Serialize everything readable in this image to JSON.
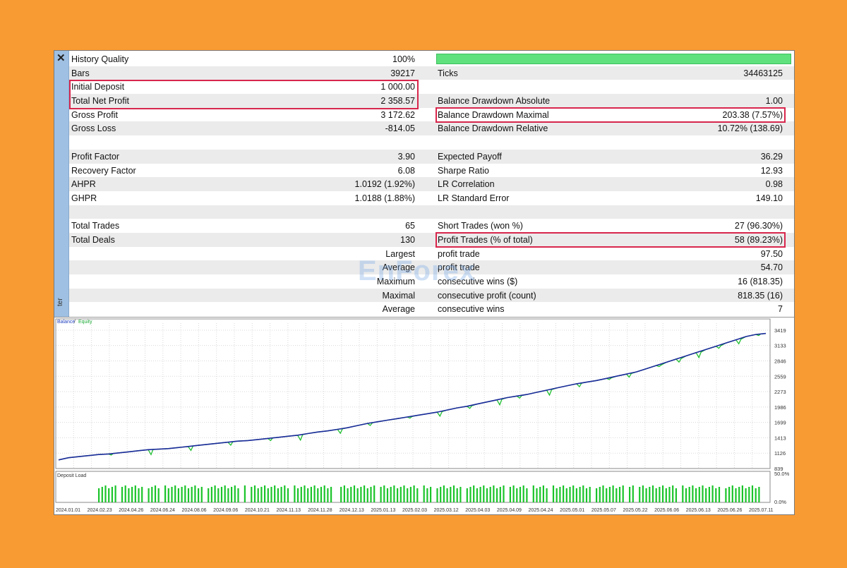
{
  "window": {
    "close_glyph": "✕",
    "vertical_label": "ter"
  },
  "rows": [
    {
      "l1": "History Quality",
      "v1": "100%",
      "l2": "",
      "v2": "",
      "bar": true
    },
    {
      "l1": "Bars",
      "v1": "39217",
      "l2": "Ticks",
      "v2": "34463125"
    },
    {
      "l1": "Initial Deposit",
      "v1": "1 000.00",
      "l2": "",
      "v2": ""
    },
    {
      "l1": "Total Net Profit",
      "v1": "2 358.57",
      "l2": "Balance Drawdown Absolute",
      "v2": "1.00"
    },
    {
      "l1": "Gross Profit",
      "v1": "3 172.62",
      "l2": "Balance Drawdown Maximal",
      "v2": "203.38 (7.57%)"
    },
    {
      "l1": "Gross Loss",
      "v1": "-814.05",
      "l2": "Balance Drawdown Relative",
      "v2": "10.72% (138.69)"
    },
    {
      "l1": "",
      "v1": "",
      "l2": "",
      "v2": ""
    },
    {
      "l1": "Profit Factor",
      "v1": "3.90",
      "l2": "Expected Payoff",
      "v2": "36.29"
    },
    {
      "l1": "Recovery Factor",
      "v1": "6.08",
      "l2": "Sharpe Ratio",
      "v2": "12.93"
    },
    {
      "l1": "AHPR",
      "v1": "1.0192 (1.92%)",
      "l2": "LR Correlation",
      "v2": "0.98"
    },
    {
      "l1": "GHPR",
      "v1": "1.0188 (1.88%)",
      "l2": "LR Standard Error",
      "v2": "149.10"
    },
    {
      "l1": "",
      "v1": "",
      "l2": "",
      "v2": ""
    },
    {
      "l1": "Total Trades",
      "v1": "65",
      "l2": "Short Trades (won %)",
      "v2": "27 (96.30%)"
    },
    {
      "l1": "Total Deals",
      "v1": "130",
      "l2": "Profit Trades (% of total)",
      "v2": "58 (89.23%)"
    },
    {
      "l1": "",
      "v1": "Largest",
      "l2": "profit trade",
      "v2": "97.50"
    },
    {
      "l1": "",
      "v1": "Average",
      "l2": "profit trade",
      "v2": "54.70"
    },
    {
      "l1": "",
      "v1": "Maximum",
      "l2": "consecutive wins ($)",
      "v2": "16 (818.35)"
    },
    {
      "l1": "",
      "v1": "Maximal",
      "l2": "consecutive profit (count)",
      "v2": "818.35 (16)"
    },
    {
      "l1": "",
      "v1": "Average",
      "l2": "consecutive wins",
      "v2": "7"
    }
  ],
  "watermark": "EnForex",
  "chart_data": {
    "type": "line",
    "legend": [
      "Balance",
      "/",
      "Equity"
    ],
    "y_ticks": [
      3419,
      3133,
      2846,
      2559,
      2273,
      1986,
      1699,
      1413,
      1126,
      839
    ],
    "x_ticks": [
      "2024.01.01",
      "2024.02.23",
      "2024.04.26",
      "2024.06.24",
      "2024.08.06",
      "2024.09.06",
      "2024.10.21",
      "2024.11.13",
      "2024.11.28",
      "2024.12.13",
      "2025.01.13",
      "2025.02.03",
      "2025.03.12",
      "2025.04.03",
      "2025.04.09",
      "2025.04.24",
      "2025.05.01",
      "2025.05.07",
      "2025.05.22",
      "2025.06.06",
      "2025.06.13",
      "2025.06.26",
      "2025.07.11"
    ],
    "ylim": [
      839,
      3550
    ],
    "balance": [
      1000,
      1040,
      1060,
      1080,
      1100,
      1110,
      1130,
      1150,
      1170,
      1190,
      1200,
      1210,
      1230,
      1250,
      1270,
      1290,
      1310,
      1330,
      1350,
      1360,
      1380,
      1400,
      1420,
      1440,
      1460,
      1490,
      1520,
      1540,
      1570,
      1600,
      1640,
      1680,
      1710,
      1740,
      1770,
      1800,
      1830,
      1860,
      1890,
      1930,
      1970,
      2000,
      2040,
      2080,
      2120,
      2160,
      2190,
      2220,
      2260,
      2300,
      2340,
      2380,
      2420,
      2450,
      2480,
      2520,
      2560,
      2600,
      2640,
      2700,
      2760,
      2820,
      2880,
      2940,
      3000,
      3060,
      3120,
      3180,
      3240,
      3300,
      3340,
      3358
    ],
    "equity_dips": [
      5,
      9,
      13,
      17,
      21,
      24,
      28,
      31,
      35,
      38,
      41,
      44,
      46,
      49,
      52,
      55,
      57,
      60,
      62,
      64,
      66,
      68,
      70
    ],
    "deposit_load": {
      "label": "Deposit Load",
      "y_ticks": [
        "50.0%",
        "0.0%"
      ]
    }
  }
}
